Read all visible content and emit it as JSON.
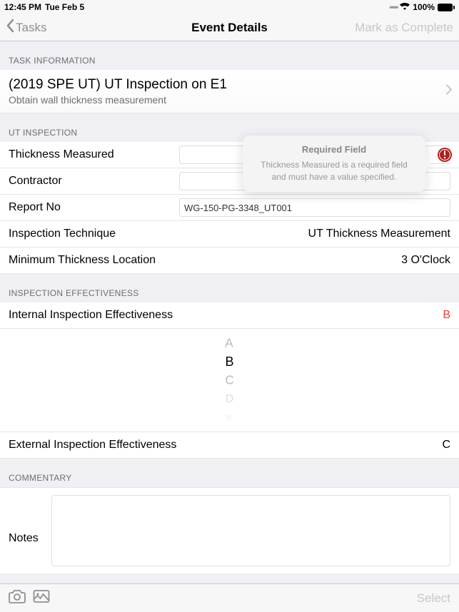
{
  "status": {
    "time": "12:45 PM",
    "date": "Tue Feb 5",
    "battery": "100%"
  },
  "nav": {
    "back": "Tasks",
    "title": "Event Details",
    "action": "Mark as Complete"
  },
  "sections": {
    "task_info": "TASK INFORMATION",
    "ut_inspection": "UT INSPECTION",
    "inspection_effectiveness": "INSPECTION EFFECTIVENESS",
    "commentary": "COMMENTARY"
  },
  "task": {
    "title": "(2019 SPE UT) UT Inspection on E1",
    "subtitle": "Obtain wall thickness measurement"
  },
  "ut": {
    "thickness_label": "Thickness Measured",
    "thickness_value": "",
    "contractor_label": "Contractor",
    "contractor_value": "",
    "reportno_label": "Report No",
    "reportno_value": "WG-150-PG-3348_UT001",
    "technique_label": "Inspection Technique",
    "technique_value": "UT Thickness Measurement",
    "minthick_label": "Minimum Thickness Location",
    "minthick_value": "3 O'Clock"
  },
  "effectiveness": {
    "internal_label": "Internal Inspection Effectiveness",
    "internal_value": "B",
    "external_label": "External Inspection Effectiveness",
    "external_value": "C"
  },
  "picker": {
    "options": [
      "A",
      "B",
      "C",
      "D",
      "e"
    ]
  },
  "commentary": {
    "notes_label": "Notes",
    "notes_value": ""
  },
  "tooltip": {
    "title": "Required Field",
    "message": "Thickness Measured is a required field and must have a value specified."
  },
  "bottom": {
    "select": "Select"
  }
}
